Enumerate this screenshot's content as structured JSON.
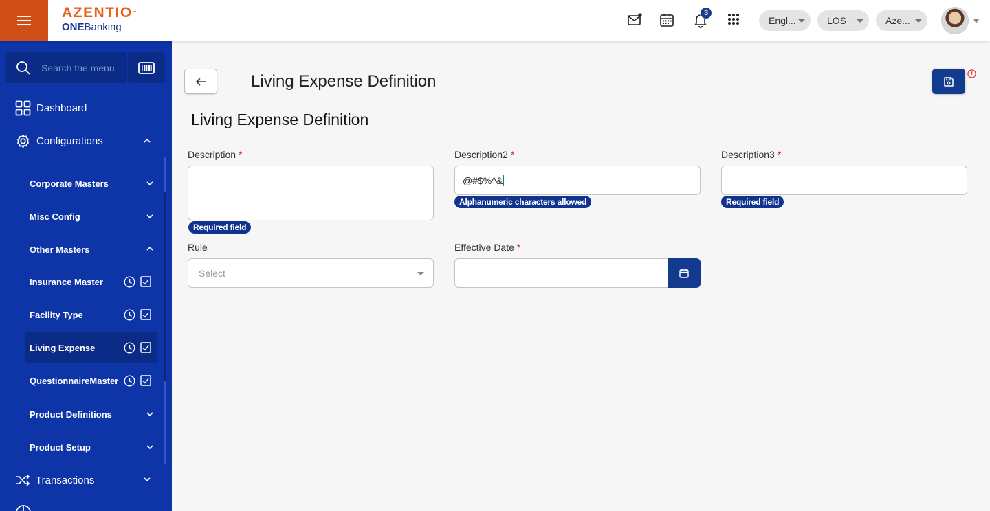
{
  "brand": {
    "name": "AZENTIO",
    "tm": "™",
    "product_bold": "ONE",
    "product_rest": "Banking"
  },
  "header": {
    "notification_count": "3",
    "language": "Engl...",
    "module": "LOS",
    "entity": "Aze...",
    "icons": [
      "mail-icon",
      "calendar-icon",
      "bell-icon",
      "apps-grid-icon"
    ]
  },
  "sidebar": {
    "search_placeholder": "Search the menu",
    "dashboard": "Dashboard",
    "configurations": "Configurations",
    "sub": {
      "corporate_masters": "Corporate Masters",
      "misc_config": "Misc Config",
      "other_masters": "Other Masters",
      "insurance_master": "Insurance Master",
      "facility_type": "Facility Type",
      "living_expense": "Living Expense",
      "questionnaire_master": "QuestionnaireMaster",
      "product_definitions": "Product Definitions",
      "product_setup": "Product Setup"
    },
    "transactions": "Transactions"
  },
  "page": {
    "title": "Living Expense Definition",
    "section_title": "Living Expense Definition",
    "required_marker": "*",
    "fields": {
      "description": {
        "label": "Description",
        "value": "",
        "error": "Required field"
      },
      "description2": {
        "label": "Description2",
        "value": "@#$%^&",
        "error": "Alphanumeric characters allowed"
      },
      "description3": {
        "label": "Description3",
        "value": "",
        "error": "Required field"
      },
      "rule": {
        "label": "Rule",
        "placeholder": "Select"
      },
      "effective_date": {
        "label": "Effective Date",
        "value": ""
      }
    }
  },
  "colors": {
    "brand_orange": "#d24e17",
    "sidebar_blue": "#0d35a8",
    "primary_button": "#123a8f",
    "required_red": "#e02020"
  }
}
